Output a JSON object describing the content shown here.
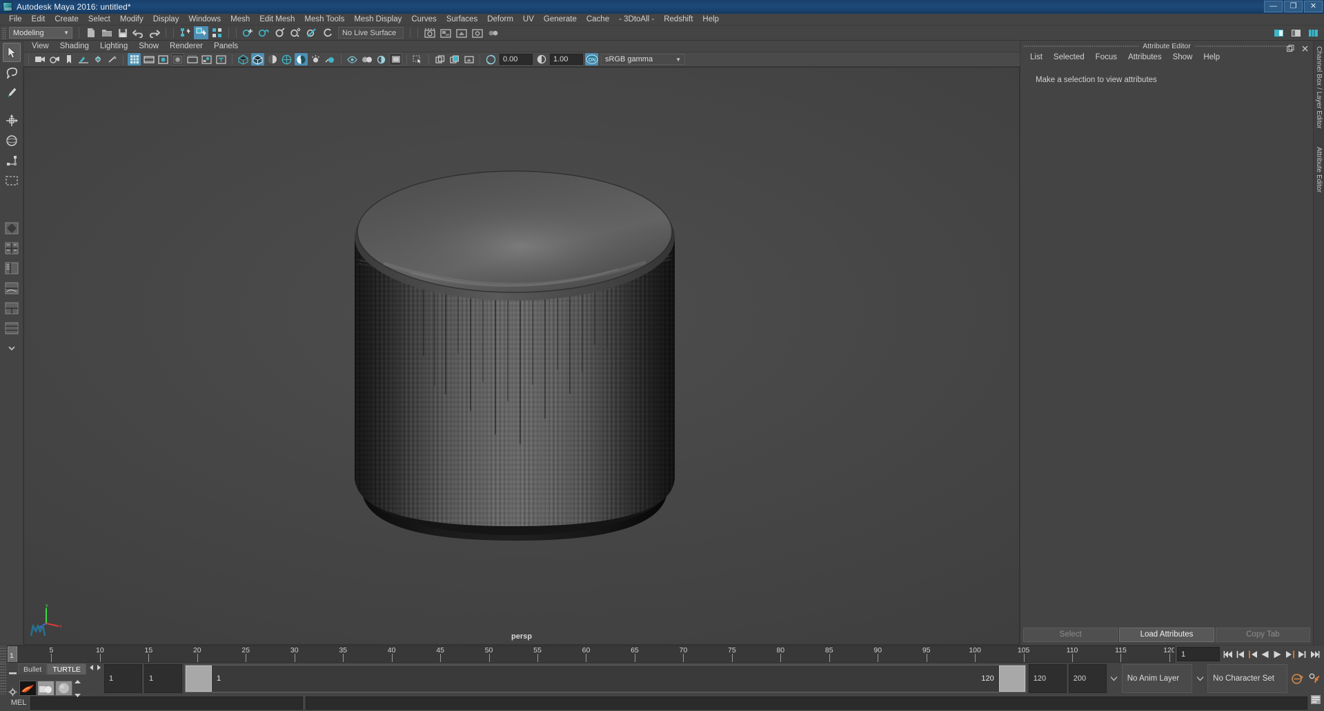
{
  "window": {
    "title": "Autodesk Maya 2016: untitled*",
    "icon": "maya-app-icon",
    "controls": [
      {
        "name": "minimize-button",
        "glyph": "—"
      },
      {
        "name": "maximize-button",
        "glyph": "❐"
      },
      {
        "name": "close-button",
        "glyph": "✕"
      }
    ]
  },
  "menubar": {
    "items": [
      "File",
      "Edit",
      "Create",
      "Select",
      "Modify",
      "Display",
      "Windows",
      "Mesh",
      "Edit Mesh",
      "Mesh Tools",
      "Mesh Display",
      "Curves",
      "Surfaces",
      "Deform",
      "UV",
      "Generate",
      "Cache",
      "- 3DtoAll -",
      "Redshift",
      "Help"
    ]
  },
  "statusline": {
    "mode_selector": {
      "value": "Modeling",
      "caret": "▼"
    },
    "live_surface": {
      "value": "No Live Surface"
    },
    "buttons": [
      "new-scene-icon",
      "open-scene-icon",
      "save-scene-icon",
      "undo-icon",
      "redo-icon",
      "select-by-hierarchy-icon",
      "select-by-object-icon",
      "select-by-component-icon",
      "snap-to-grid-icon",
      "snap-to-curve-icon",
      "snap-to-point-icon",
      "snap-to-projected-center-icon",
      "snap-to-view-plane-icon",
      "make-live-icon",
      "show-render-view-icon",
      "render-current-frame-icon",
      "ipr-render-icon",
      "render-settings-icon",
      "hypershade-icon"
    ],
    "right_buttons": [
      "sidebar-attribute-editor-icon",
      "sidebar-tool-settings-icon",
      "sidebar-channel-box-icon"
    ]
  },
  "panel": {
    "menubar": [
      "View",
      "Shading",
      "Lighting",
      "Show",
      "Renderer",
      "Panels"
    ],
    "toolbar": {
      "exposure_value": "0.00",
      "gamma_value": "1.00",
      "color_management_toggle": "ON",
      "color_profile": "sRGB gamma",
      "caret": "▼",
      "buttons": [
        "select-camera-icon",
        "camera-attributes-icon",
        "bookmark-icon",
        "image-plane-icon",
        "two-sided-lighting-icon",
        "lighting-toggle-icon",
        "grid-toggle-icon",
        "film-gate-icon",
        "resolution-gate-icon",
        "gate-mask-icon",
        "film-origin-icon",
        "xray-joints-icon",
        "texture-text-icon",
        "wireframe-icon",
        "smooth-shade-all-icon",
        "shaded-wireframe-icon",
        "hardware-texturing-icon",
        "use-default-material-icon",
        "xray-mode-icon",
        "xray-active-components-icon",
        "isolate-select-icon",
        "render-region-icon",
        "snapshot-icon",
        "screenshot-icon",
        "exposure-icon",
        "gamma-icon"
      ]
    },
    "viewport": {
      "camera_label": "persp"
    }
  },
  "toolbox": {
    "tools": [
      {
        "name": "select-tool",
        "selected": true
      },
      {
        "name": "lasso-select-tool",
        "selected": false
      },
      {
        "name": "paint-select-tool",
        "selected": false
      },
      {
        "name": "move-tool",
        "selected": false
      },
      {
        "name": "rotate-tool",
        "selected": false
      },
      {
        "name": "scale-tool",
        "selected": false
      },
      {
        "name": "last-tool-used",
        "selected": false
      }
    ],
    "layouts": [
      "single-perspective-layout",
      "four-view-layout",
      "outliner-persp-layout",
      "persp-graph-layout",
      "hypershade-persp-layout",
      "persp-outliner-layout",
      "more-layouts"
    ]
  },
  "attribute_editor": {
    "title": "Attribute Editor",
    "menubar": [
      "List",
      "Selected",
      "Focus",
      "Attributes",
      "Show",
      "Help"
    ],
    "message": "Make a selection to view attributes",
    "footer_buttons": [
      {
        "label": "Select",
        "enabled": false
      },
      {
        "label": "Load Attributes",
        "enabled": true
      },
      {
        "label": "Copy Tab",
        "enabled": false
      }
    ],
    "titlebar_icons": [
      "undock-panel-icon",
      "close-panel-icon"
    ]
  },
  "right_tabs": [
    "Channel Box / Layer Editor",
    "Attribute Editor"
  ],
  "timeslider": {
    "start": 1,
    "end": 120,
    "current_frame": "1",
    "tick_labels": [
      5,
      10,
      15,
      20,
      25,
      30,
      35,
      40,
      45,
      50,
      55,
      60,
      65,
      70,
      75,
      80,
      85,
      90,
      95,
      100,
      105,
      110,
      115,
      120
    ],
    "current_field_value": "1",
    "transport_buttons": [
      "go-to-start-icon",
      "step-back-frame-icon",
      "step-back-key-icon",
      "play-backwards-icon",
      "play-forwards-icon",
      "step-forward-key-icon",
      "step-forward-frame-icon",
      "go-to-end-icon"
    ]
  },
  "rangeslider": {
    "anim_start": "1",
    "range_start": "1",
    "bar_start_label": "1",
    "bar_end_label": "120",
    "range_end": "120",
    "anim_end": "200",
    "anim_layer": {
      "value": "No Anim Layer",
      "caret": "▽"
    },
    "character_set": {
      "value": "No Character Set",
      "caret": "▽"
    },
    "buttons": [
      "auto-key-icon",
      "animation-preferences-icon"
    ]
  },
  "shelf_mini": {
    "tabs": [
      {
        "label": "Bullet",
        "active": false
      },
      {
        "label": "TURTLE",
        "active": true
      }
    ],
    "arrows": [
      "shelf-prev-icon",
      "shelf-next-icon"
    ],
    "icons": [
      "turtle-render-icon",
      "turtle-bake-icon",
      "turtle-material-icon"
    ],
    "side_icons": [
      "shelf-menu-icon",
      "shelf-options-icon"
    ],
    "spinner": [
      "shelf-scroll-up-icon",
      "shelf-scroll-down-icon"
    ]
  },
  "commandline": {
    "language_label": "MEL",
    "input_value": "",
    "input_placeholder": "",
    "output_value": "",
    "script-editor-icon": "script-editor-icon"
  },
  "colors": {
    "accent_blue": "#4d8fb5",
    "titlebar_blue": "#1d4a7a",
    "panel_bg": "#444444",
    "field_bg": "#2b2b2b",
    "orange": "#e07b39"
  }
}
